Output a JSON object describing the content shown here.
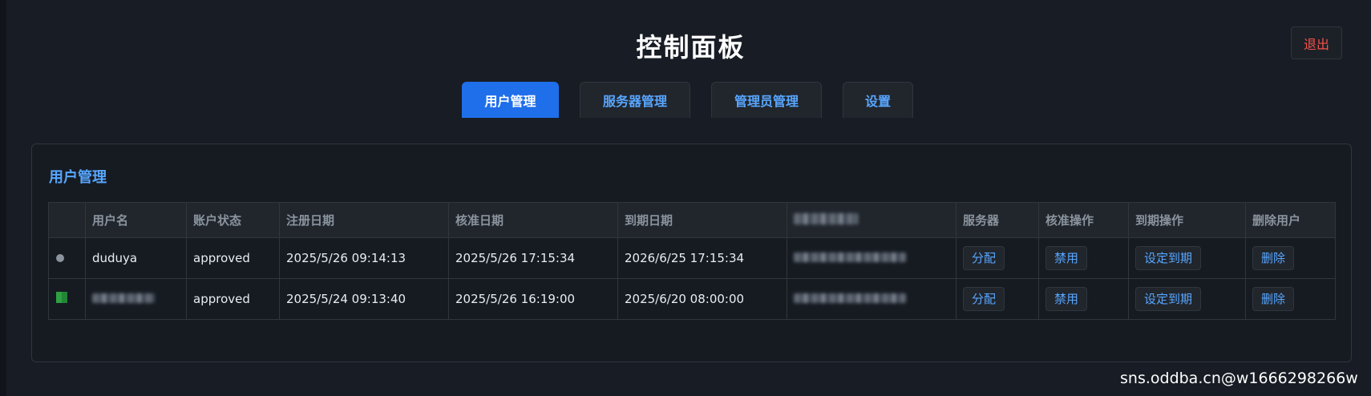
{
  "header": {
    "title": "控制面板",
    "logout_label": "退出"
  },
  "tabs": [
    {
      "label": "用户管理",
      "active": true
    },
    {
      "label": "服务器管理",
      "active": false
    },
    {
      "label": "管理员管理",
      "active": false
    },
    {
      "label": "设置",
      "active": false
    }
  ],
  "panel": {
    "title": "用户管理"
  },
  "table": {
    "columns": [
      "",
      "用户名",
      "账户状态",
      "注册日期",
      "核准日期",
      "到期日期",
      "",
      "服务器",
      "核准操作",
      "到期操作",
      "删除用户"
    ],
    "rows": [
      {
        "status_icon": "gray-dot-icon",
        "username": "duduya",
        "account_status": "approved",
        "register_date": "2025/5/26 09:14:13",
        "approve_date": "2025/5/26 17:15:34",
        "expire_date": "2026/6/25 17:15:34"
      },
      {
        "status_icon": "green-square-icon",
        "username": "",
        "account_status": "approved",
        "register_date": "2025/5/24 09:13:40",
        "approve_date": "2025/5/26 16:19:00",
        "expire_date": "2025/6/20 08:00:00"
      }
    ],
    "actions": {
      "assign_label": "分配",
      "disable_label": "禁用",
      "set_expiry_label": "设定到期",
      "delete_label": "删除"
    }
  },
  "watermark": "sns.oddba.cn@w1666298266w",
  "colors": {
    "background": "#181c24",
    "accent": "#1f6feb",
    "link": "#58a6ff",
    "danger": "#f85149"
  }
}
